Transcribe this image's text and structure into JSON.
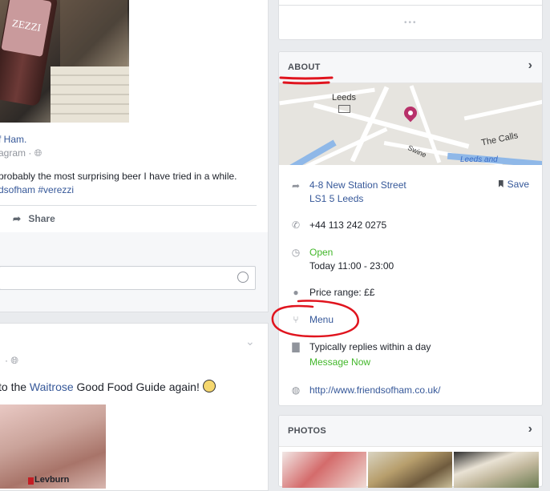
{
  "post1": {
    "bottle_label": "ZEZZI",
    "page_name": "f Ham.",
    "meta": "agram ·",
    "text_line1": "probably the most surprising beer I have tried in a while.",
    "text_line2": "dsofham #verezzi",
    "share_label": "Share"
  },
  "post2": {
    "text_before": "to the ",
    "text_link": "Waitrose",
    "text_after": " Good Food Guide again!",
    "photo_text": "Levburn"
  },
  "about": {
    "title": "ABOUT",
    "map_labels": {
      "leeds": "Leeds",
      "the_calls": "The Calls",
      "swinegate": "Swine",
      "leeds_and": "Leeds and"
    },
    "address_line1": "4-8 New Station Street",
    "address_line2": "LS1 5 Leeds",
    "save_label": "Save",
    "phone": "+44 113 242 0275",
    "hours_status": "Open",
    "hours_today": "Today 11:00 - 23:00",
    "price_range": "Price range: ££",
    "menu_label": "Menu",
    "replies": "Typically replies within a day",
    "message_now": "Message Now",
    "website": "http://www.friendsofham.co.uk/"
  },
  "photos": {
    "title": "PHOTOS"
  },
  "colors": {
    "link": "#365899",
    "green": "#42b72a",
    "annotation_red": "#e0141e",
    "map_pin": "#b8316a"
  }
}
